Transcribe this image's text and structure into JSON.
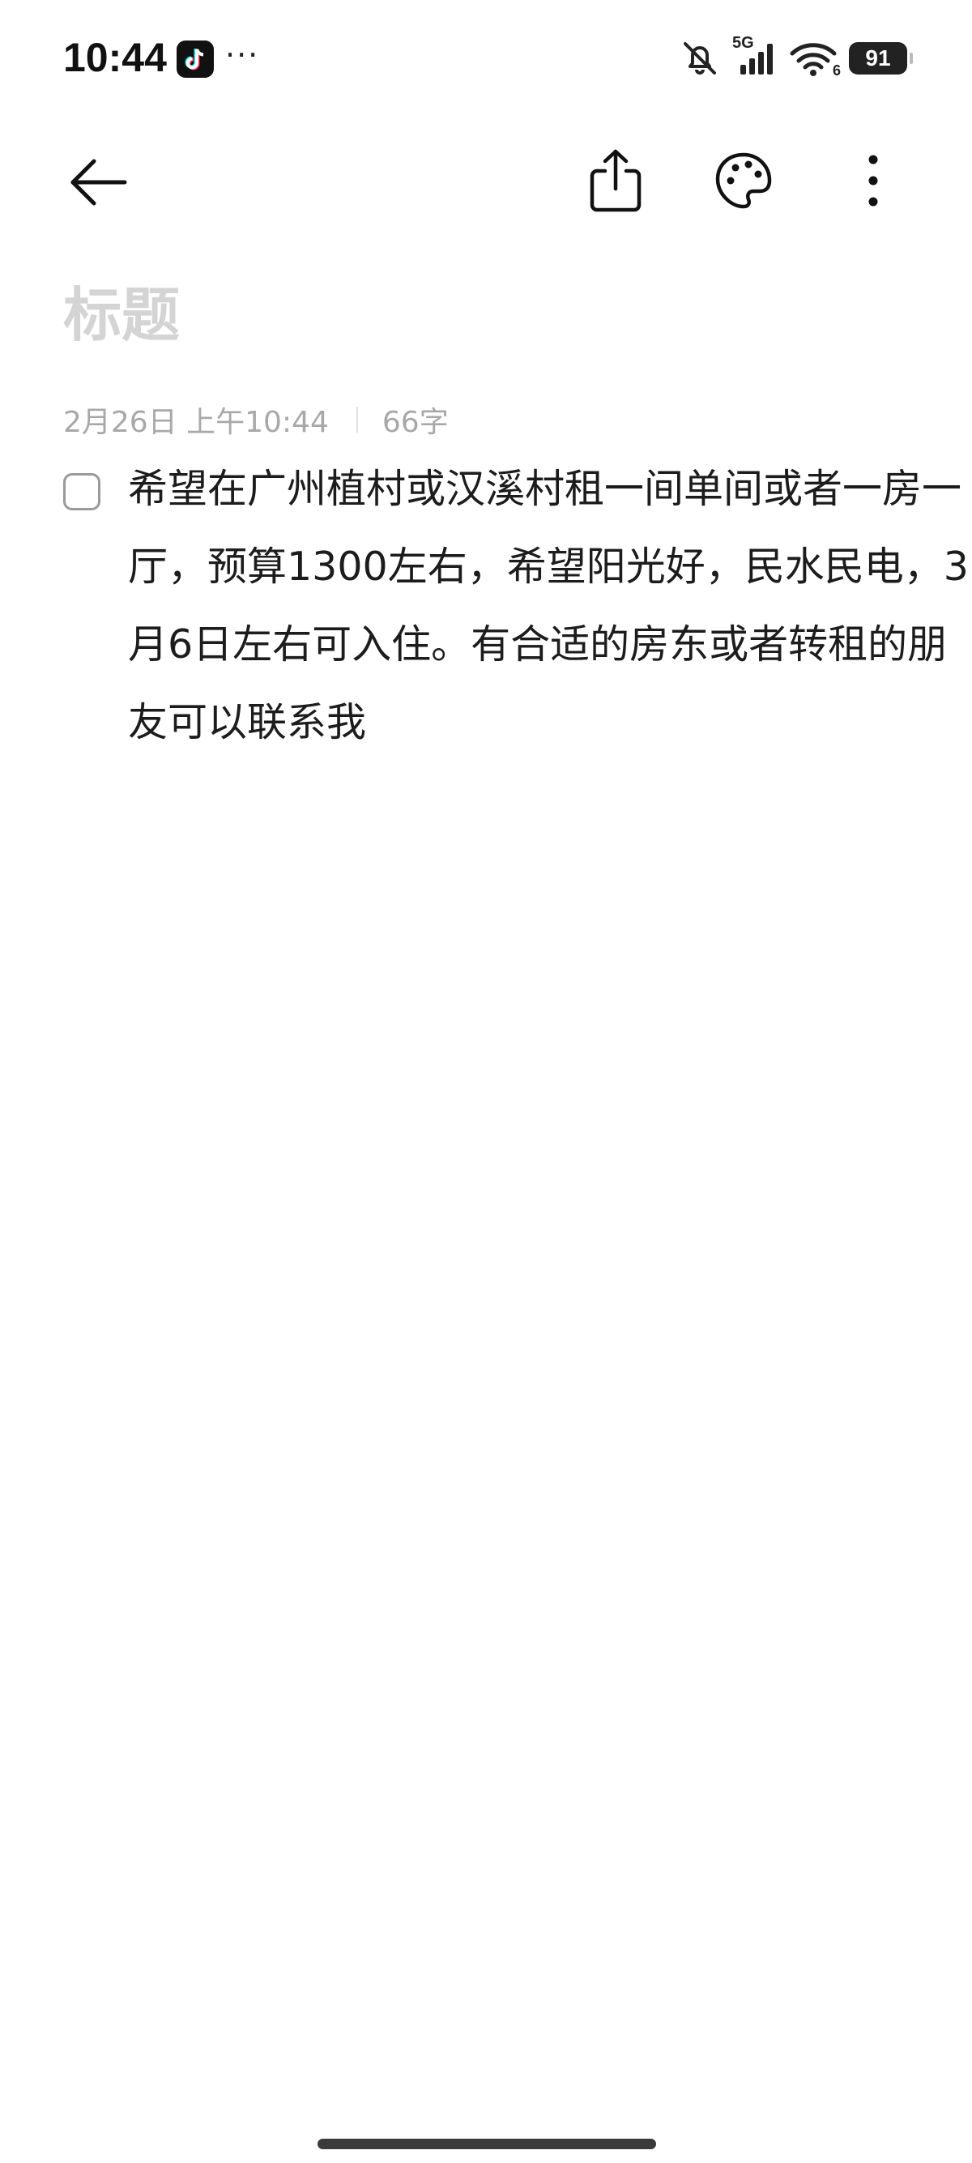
{
  "status_bar": {
    "time": "10:44",
    "more": "···",
    "network": "5G",
    "wifi_badge": "6",
    "battery": "91",
    "icons": [
      "tiktok-icon",
      "muted-bell-icon",
      "signal-icon",
      "wifi-icon",
      "battery-icon"
    ]
  },
  "toolbar": {
    "icons": [
      "back-arrow-icon",
      "share-icon",
      "palette-icon",
      "more-vertical-icon"
    ]
  },
  "note": {
    "title_placeholder": "标题",
    "date": "2月26日 上午10:44",
    "word_count": "66字",
    "checklist": [
      {
        "checked": false,
        "text": "希望在广州植村或汉溪村租一间单间或者一房一厅，预算1300左右，希望阳光好，民水民电，3月6日左右可入住。有合适的房东或者转租的朋友可以联系我"
      }
    ]
  },
  "colors": {
    "background": "#ffffff",
    "title_placeholder": "#d4d4d4",
    "meta": "#a8a8a8",
    "body_text": "#1c1c1c"
  }
}
